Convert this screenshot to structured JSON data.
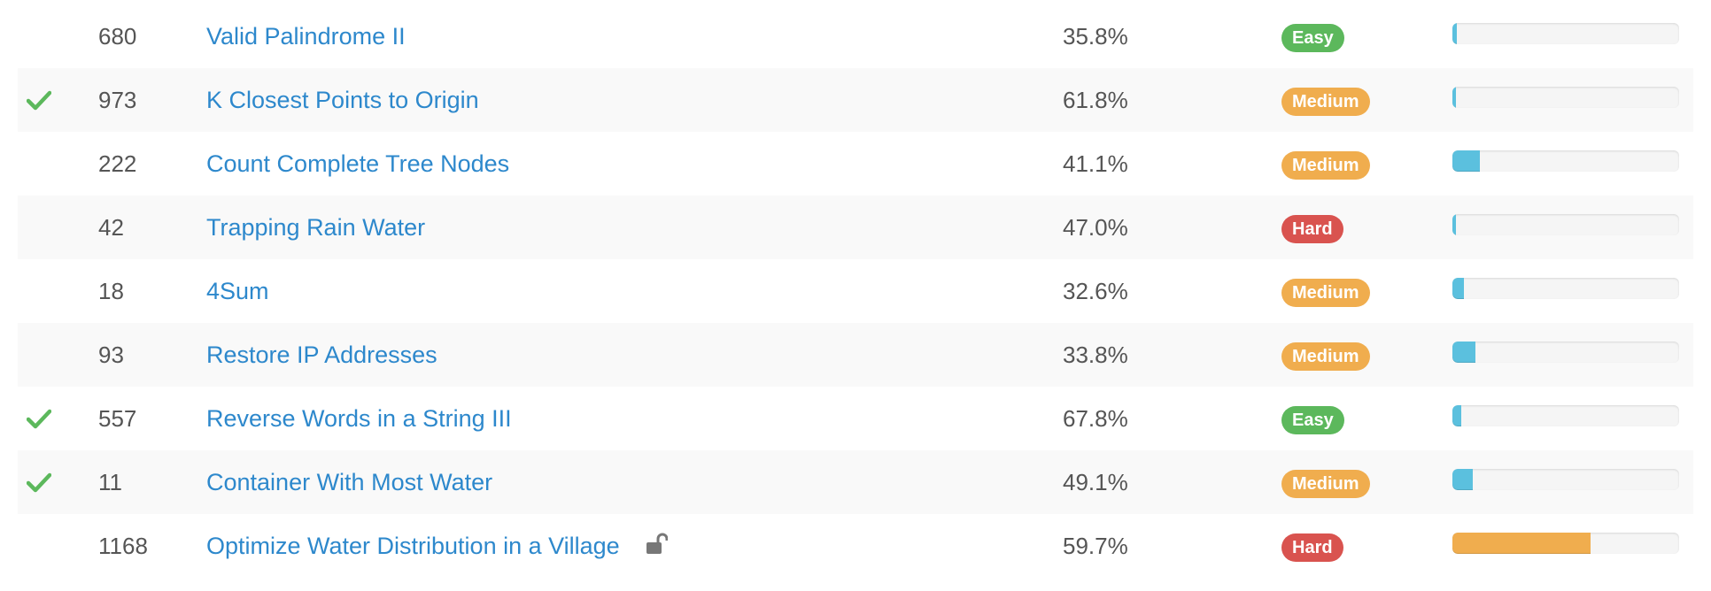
{
  "colors": {
    "link": "#2d88cc",
    "text": "#555555",
    "check": "#5cb85c",
    "easy": "#5cb85c",
    "medium": "#f0ad4e",
    "hard": "#d9534f",
    "progress_info": "#5bc0de",
    "progress_warning": "#f0ad4e",
    "progress_track": "#f5f5f5",
    "row_stripe": "#f9f9f9"
  },
  "problems": [
    {
      "solved": false,
      "id": "680",
      "title": "Valid Palindrome II",
      "locked": false,
      "acceptance": "35.8%",
      "difficulty": "Easy",
      "frequency": 0.02,
      "frequency_color": "info"
    },
    {
      "solved": true,
      "id": "973",
      "title": "K Closest Points to Origin",
      "locked": false,
      "acceptance": "61.8%",
      "difficulty": "Medium",
      "frequency": 0.015,
      "frequency_color": "info"
    },
    {
      "solved": false,
      "id": "222",
      "title": "Count Complete Tree Nodes",
      "locked": false,
      "acceptance": "41.1%",
      "difficulty": "Medium",
      "frequency": 0.12,
      "frequency_color": "info"
    },
    {
      "solved": false,
      "id": "42",
      "title": "Trapping Rain Water",
      "locked": false,
      "acceptance": "47.0%",
      "difficulty": "Hard",
      "frequency": 0.01,
      "frequency_color": "info"
    },
    {
      "solved": false,
      "id": "18",
      "title": "4Sum",
      "locked": false,
      "acceptance": "32.6%",
      "difficulty": "Medium",
      "frequency": 0.05,
      "frequency_color": "info"
    },
    {
      "solved": false,
      "id": "93",
      "title": "Restore IP Addresses",
      "locked": false,
      "acceptance": "33.8%",
      "difficulty": "Medium",
      "frequency": 0.1,
      "frequency_color": "info"
    },
    {
      "solved": true,
      "id": "557",
      "title": "Reverse Words in a String III",
      "locked": false,
      "acceptance": "67.8%",
      "difficulty": "Easy",
      "frequency": 0.04,
      "frequency_color": "info"
    },
    {
      "solved": true,
      "id": "11",
      "title": "Container With Most Water",
      "locked": false,
      "acceptance": "49.1%",
      "difficulty": "Medium",
      "frequency": 0.09,
      "frequency_color": "info"
    },
    {
      "solved": false,
      "id": "1168",
      "title": "Optimize Water Distribution in a Village",
      "locked": true,
      "acceptance": "59.7%",
      "difficulty": "Hard",
      "frequency": 0.61,
      "frequency_color": "warning"
    }
  ],
  "icons": {
    "solved": "check-icon",
    "locked": "unlocked-padlock-icon"
  }
}
